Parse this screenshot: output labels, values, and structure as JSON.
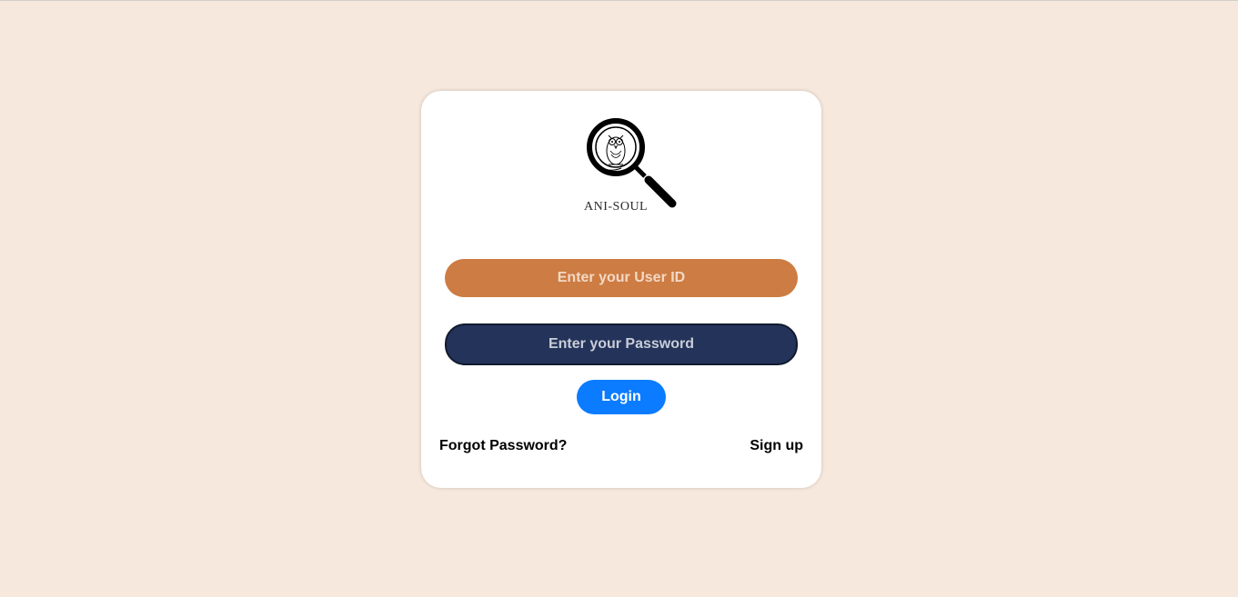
{
  "brand": {
    "name": "ANI-SOUL",
    "logo_icon": "owl-magnifier-icon"
  },
  "form": {
    "user_id_placeholder": "Enter your User ID",
    "password_placeholder": "Enter your Password",
    "login_label": "Login"
  },
  "links": {
    "forgot_password": "Forgot Password?",
    "sign_up": "Sign up"
  },
  "colors": {
    "background": "#f6e8dc",
    "user_id_field": "#cd7c43",
    "password_field": "#24335a",
    "login_button": "#0b7cff"
  }
}
